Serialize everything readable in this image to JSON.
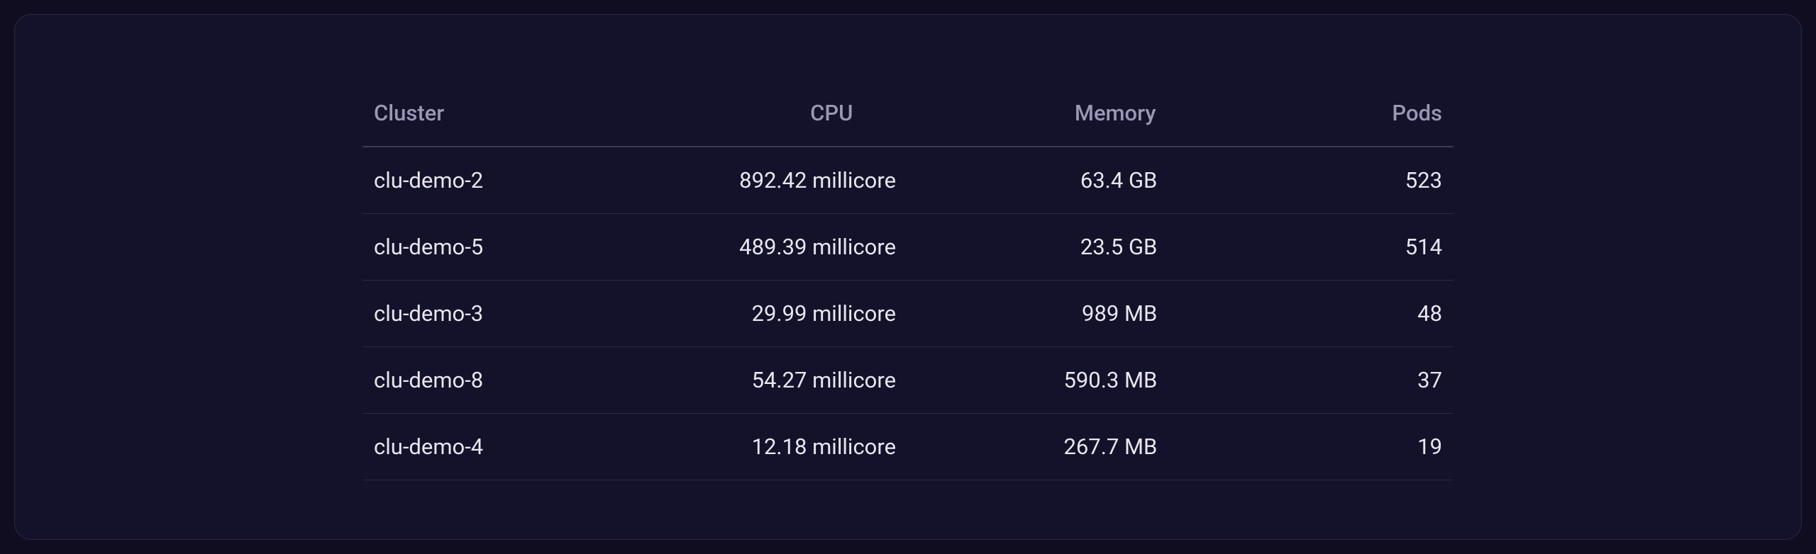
{
  "table": {
    "headers": {
      "cluster": "Cluster",
      "cpu": "CPU",
      "memory": "Memory",
      "pods": "Pods"
    },
    "rows": [
      {
        "cluster": "clu-demo-2",
        "cpu": "892.42 millicore",
        "memory": "63.4 GB",
        "pods": "523"
      },
      {
        "cluster": "clu-demo-5",
        "cpu": "489.39 millicore",
        "memory": "23.5 GB",
        "pods": "514"
      },
      {
        "cluster": "clu-demo-3",
        "cpu": "29.99 millicore",
        "memory": "989 MB",
        "pods": "48"
      },
      {
        "cluster": "clu-demo-8",
        "cpu": "54.27 millicore",
        "memory": "590.3 MB",
        "pods": "37"
      },
      {
        "cluster": "clu-demo-4",
        "cpu": "12.18 millicore",
        "memory": "267.7 MB",
        "pods": "19"
      }
    ]
  }
}
